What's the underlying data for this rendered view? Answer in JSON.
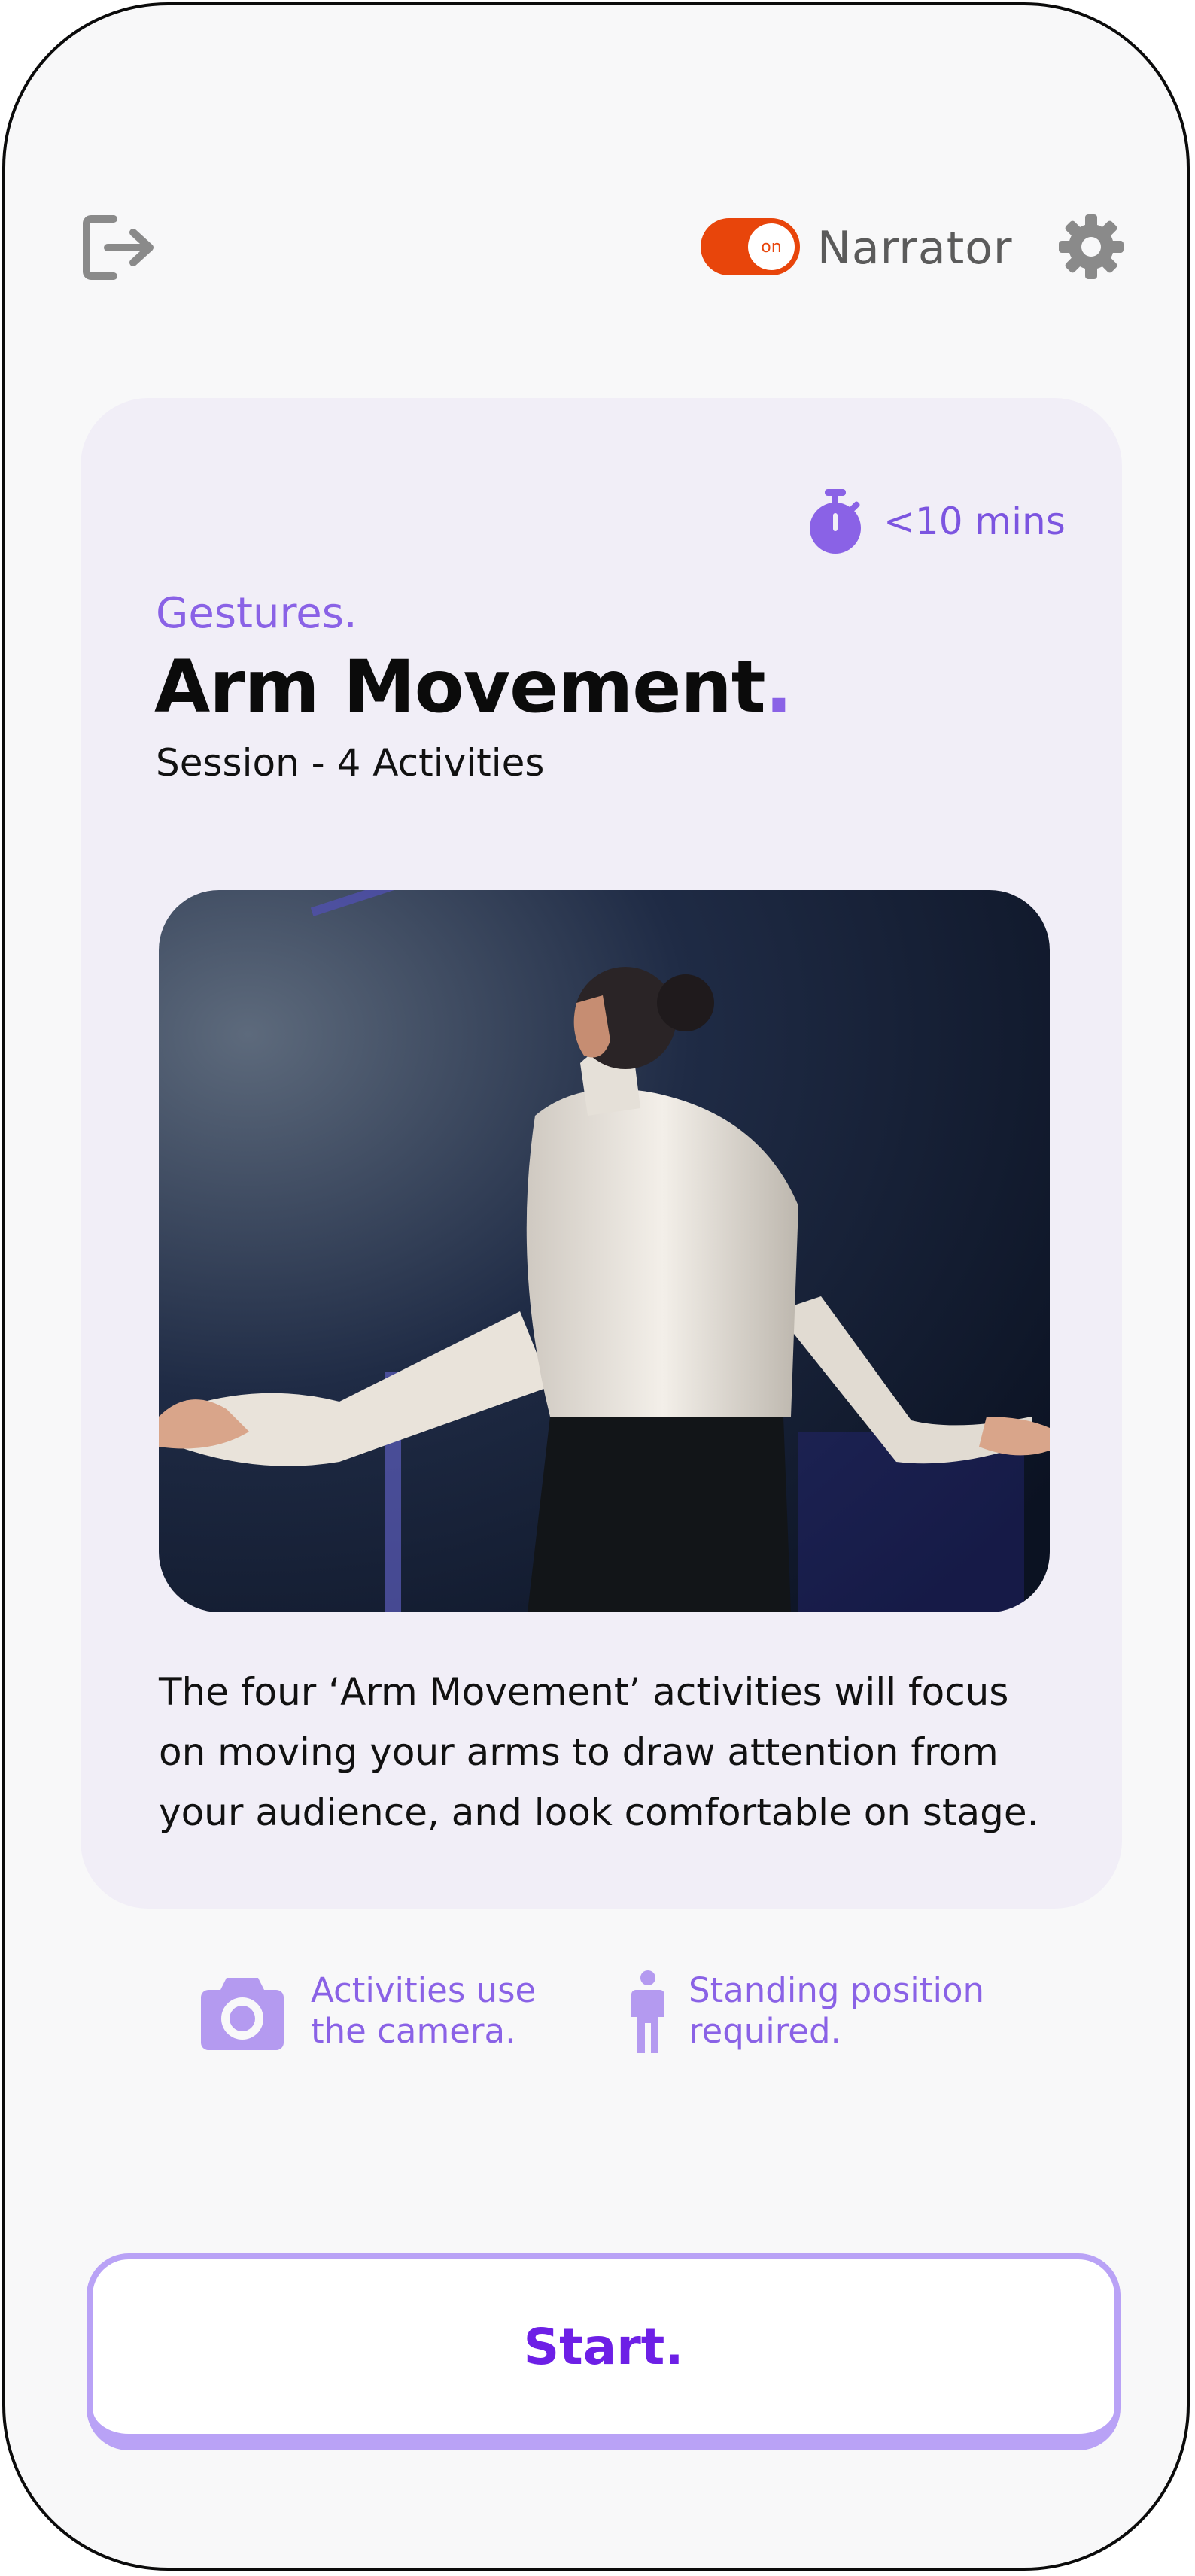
{
  "header": {
    "narrator_state": "on",
    "narrator_label": "Narrator",
    "icons": {
      "logout": "logout-icon",
      "settings": "gear-icon"
    }
  },
  "session": {
    "duration": "<10 mins",
    "category": "Gestures.",
    "title": "Arm Movement",
    "title_punctuation": ".",
    "subtitle": "Session - 4 Activities",
    "description": "The four ‘Arm Movement’ activities will focus on moving your arms to draw attention from your audience, and look comfortable on stage."
  },
  "requirements": [
    {
      "icon": "camera-icon",
      "text": "Activities use\nthe camera."
    },
    {
      "icon": "person-standing-icon",
      "text": "Standing position\nrequired."
    }
  ],
  "actions": {
    "start_label": "Start."
  },
  "colors": {
    "accent": "#8a62e6",
    "start_text": "#6d1fe6",
    "toggle_on": "#e8450b",
    "card_bg": "#f1eef7"
  }
}
